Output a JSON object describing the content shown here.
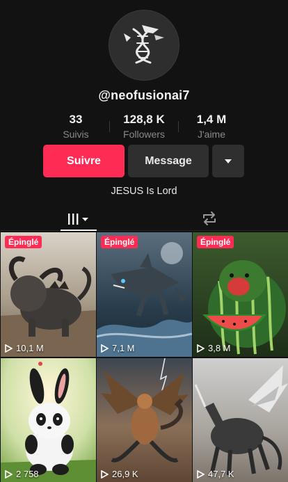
{
  "profile": {
    "handle": "@neofusionai7",
    "stats": [
      {
        "value": "33",
        "label": "Suivis"
      },
      {
        "value": "128,8 K",
        "label": "Followers"
      },
      {
        "value": "1,4 M",
        "label": "J'aime"
      }
    ],
    "bio": "JESUS Is Lord"
  },
  "actions": {
    "follow_label": "Suivre",
    "message_label": "Message",
    "more_icon": "caret-down-icon"
  },
  "colors": {
    "background": "#121212",
    "accent": "#fe2c55",
    "button_secondary": "#2f2f2f",
    "muted_text": "#8a8a8a"
  },
  "tabs": [
    {
      "icon": "videos-grid-icon",
      "active": true
    },
    {
      "icon": "repost-icon",
      "active": false
    }
  ],
  "videos": [
    {
      "pinned": true,
      "pin_label": "Épinglé",
      "views": "10,1 M"
    },
    {
      "pinned": true,
      "pin_label": "Épinglé",
      "views": "7,1 M"
    },
    {
      "pinned": true,
      "pin_label": "Épinglé",
      "views": "3,8 M"
    },
    {
      "pinned": false,
      "pin_label": "",
      "views": "2 758"
    },
    {
      "pinned": false,
      "pin_label": "",
      "views": "26,9 K"
    },
    {
      "pinned": false,
      "pin_label": "",
      "views": "47,7 K"
    }
  ]
}
